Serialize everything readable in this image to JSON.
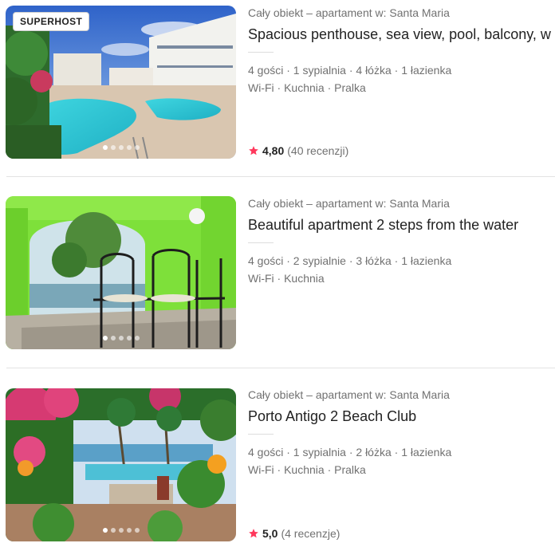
{
  "listings": [
    {
      "badge": "SUPERHOST",
      "type": "Cały obiekt – apartament w: Santa Maria",
      "title": "Spacious penthouse, sea view, pool, balcony, wifi",
      "details": "4 gości · 1 sypialnia · 4 łóżka · 1 łazienka",
      "amenities": "Wi-Fi · Kuchnia · Pralka",
      "rating": "4,80",
      "reviews": "(40 recenzji)",
      "photo_icon": "pool-resort-photo",
      "photo_dots": 5,
      "photo_active_index": 0
    },
    {
      "type": "Cały obiekt – apartament w: Santa Maria",
      "title": "Beautiful apartment 2 steps from the water",
      "details": "4 gości · 2 sypialnie · 3 łóżka · 1 łazienka",
      "amenities": "Wi-Fi · Kuchnia",
      "photo_icon": "green-terrace-photo",
      "photo_dots": 5,
      "photo_active_index": 0
    },
    {
      "type": "Cały obiekt – apartament w: Santa Maria",
      "title": "Porto Antigo 2 Beach Club",
      "details": "4 gości · 1 sypialnia · 2 łóżka · 1 łazienka",
      "amenities": "Wi-Fi · Kuchnia · Pralka",
      "rating": "5,0",
      "reviews": "(4 recenzje)",
      "photo_icon": "garden-pool-photo",
      "photo_dots": 5,
      "photo_active_index": 0
    }
  ],
  "colors": {
    "star": "#FF385C",
    "secondary_text": "#717171",
    "primary_text": "#222222",
    "divider": "#E3E3E3"
  }
}
